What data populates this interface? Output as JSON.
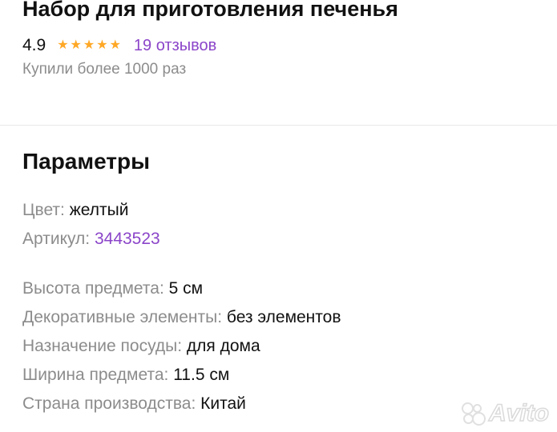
{
  "product": {
    "title": "Набор для приготовления печенья",
    "rating": "4.9",
    "stars": 5,
    "star_color": "#ffa826",
    "reviews": "19 отзывов",
    "bought": "Купили более 1000 раз"
  },
  "params": {
    "title": "Параметры",
    "color_label": "Цвет:",
    "color_value": "желтый",
    "article_label": "Артикул:",
    "article_value": "3443523",
    "height_label": "Высота предмета:",
    "height_value": "5 см",
    "decor_label": "Декоративные элементы:",
    "decor_value": "без элементов",
    "purpose_label": "Назначение посуды:",
    "purpose_value": "для дома",
    "width_label": "Ширина предмета:",
    "width_value": "11.5 см",
    "country_label": "Страна производства:",
    "country_value": "Китай"
  },
  "watermark": "Avito",
  "colors": {
    "accent_link": "#8b45c9",
    "muted_text": "#8c8c8c"
  }
}
